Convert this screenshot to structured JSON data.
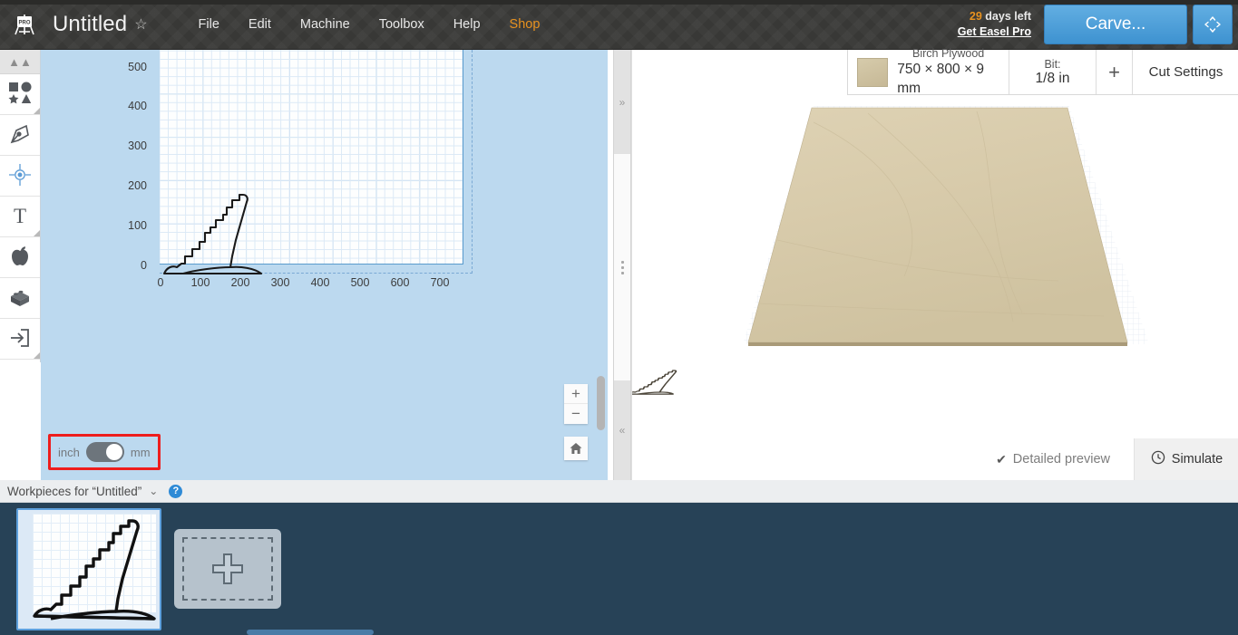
{
  "app": {
    "logo_icon": "easel-pro-logo-icon",
    "document_title": "Untitled",
    "favorite_icon": "star-icon"
  },
  "menu": {
    "items": [
      {
        "label": "File",
        "name": "menu-file"
      },
      {
        "label": "Edit",
        "name": "menu-edit"
      },
      {
        "label": "Machine",
        "name": "menu-machine"
      },
      {
        "label": "Toolbox",
        "name": "menu-toolbox"
      },
      {
        "label": "Help",
        "name": "menu-help"
      },
      {
        "label": "Shop",
        "name": "menu-shop"
      }
    ]
  },
  "header_right": {
    "trial_days": "29",
    "trial_text": " days left",
    "upgrade_link": "Get Easel Pro",
    "carve_label": "Carve...",
    "fullscreen_icon": "fullscreen-expand-icon",
    "accent_orange": "#e8921f",
    "carve_blue": "#3e92d0"
  },
  "toolbar": {
    "collapse_icon": "chevron-double-up-icon",
    "items": [
      {
        "name": "tool-shapes",
        "icon": "shapes-icon",
        "label": "Shapes"
      },
      {
        "name": "tool-draw",
        "icon": "pen-nib-icon",
        "label": "Draw"
      },
      {
        "name": "tool-center",
        "icon": "center-point-icon",
        "label": "Center Point"
      },
      {
        "name": "tool-text",
        "icon": "text-t-icon",
        "label": "Text"
      },
      {
        "name": "tool-apps",
        "icon": "apple-icon",
        "label": "Apps"
      },
      {
        "name": "tool-parts",
        "icon": "lego-brick-icon",
        "label": "Parts"
      },
      {
        "name": "tool-import",
        "icon": "import-arrow-icon",
        "label": "Import"
      }
    ]
  },
  "canvas": {
    "y_ticks": [
      "500",
      "400",
      "300",
      "200",
      "100",
      "0"
    ],
    "x_ticks": [
      "0",
      "100",
      "200",
      "300",
      "400",
      "500",
      "600",
      "700"
    ],
    "units_left": "inch",
    "units_right": "mm",
    "unit_selected": "mm",
    "zoom_in_icon": "plus-icon",
    "zoom_out_icon": "minus-icon",
    "home_icon": "home-icon",
    "vertical_scrollbar": "canvas-vertical-scrollbar",
    "drag_handle": "canvas-resize-handle"
  },
  "splitter": {
    "expand_right_icon": "chevron-double-right-icon",
    "grip_icon": "grip-dots-icon",
    "collapse_left_icon": "chevron-double-left-icon"
  },
  "material_bar": {
    "swatch": "birch-plywood-swatch",
    "material_name": "Birch Plywood",
    "material_size": "750 × 800 × 9 mm",
    "bit_label": "Bit:",
    "bit_value": "1/8 in",
    "add_label": "+",
    "cut_settings_label": "Cut Settings"
  },
  "preview": {
    "detailed_preview_label": "Detailed preview",
    "detailed_preview_check": "check-icon",
    "simulate_label": "Simulate",
    "simulate_icon": "clock-icon",
    "board_color": "#d9cdae"
  },
  "workpieces": {
    "title": "Workpieces for “Untitled”",
    "collapse_icon": "chevron-double-down-icon",
    "help_icon": "question-mark-icon",
    "items": [
      {
        "name": "workpiece-thumbnail-1",
        "selected": true
      }
    ],
    "add_label": "add-workpiece-button"
  },
  "chart_data": {
    "type": "scatter",
    "title": "",
    "xlabel": "",
    "ylabel": "",
    "xlim": [
      0,
      750
    ],
    "ylim": [
      0,
      520
    ],
    "x_ticks": [
      0,
      100,
      200,
      300,
      400,
      500,
      600,
      700
    ],
    "y_ticks": [
      0,
      100,
      200,
      300,
      400,
      500
    ],
    "grid": true,
    "legend": "none",
    "annotations": [
      "stepped-mountain-outline-path"
    ]
  }
}
